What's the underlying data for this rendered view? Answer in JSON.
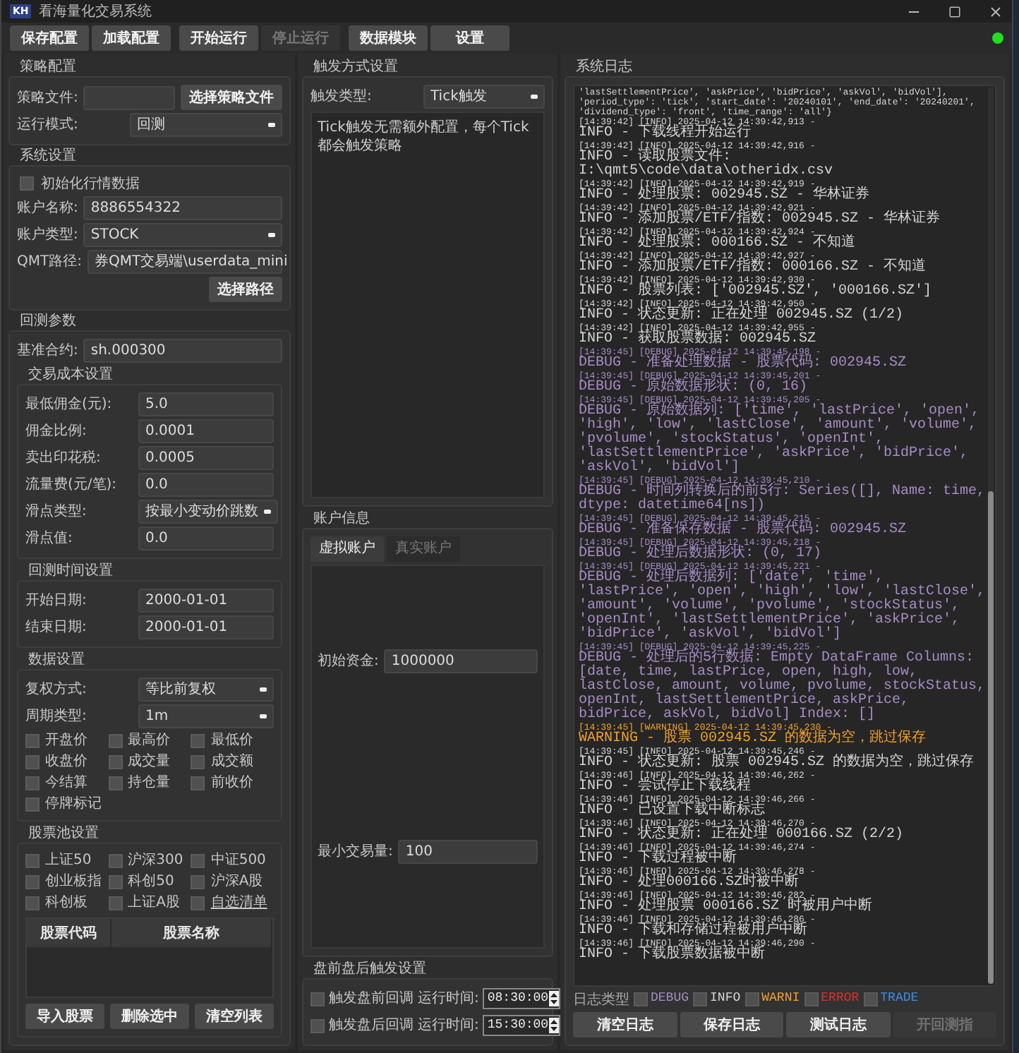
{
  "window": {
    "logo_text": "KH",
    "title": "看海量化交易系统"
  },
  "toolbar": [
    {
      "label": "保存配置",
      "disabled": false
    },
    {
      "label": "加载配置",
      "disabled": false
    },
    {
      "label": "开始运行",
      "disabled": false
    },
    {
      "label": "停止运行",
      "disabled": true
    },
    {
      "label": "数据模块",
      "disabled": false
    },
    {
      "label": "设置",
      "disabled": false
    }
  ],
  "status_light": {
    "on": true
  },
  "strategy_config": {
    "title": "策略配置",
    "file_label": "策略文件:",
    "file_button": "选择策略文件",
    "mode_label": "运行模式:",
    "mode_value": "回测"
  },
  "system_settings": {
    "title": "系统设置",
    "init_data": {
      "label": "初始化行情数据",
      "checked": false
    },
    "account_name_label": "账户名称:",
    "account_name": "8886554322",
    "account_type_label": "账户类型:",
    "account_type": "STOCK",
    "qmt_path_label": "QMT路径:",
    "qmt_path": "券QMT交易端\\userdata_mini",
    "path_button": "选择路径"
  },
  "backtest": {
    "title": "回测参数",
    "benchmark_label": "基准合约:",
    "benchmark": "sh.000300",
    "cost": {
      "title": "交易成本设置",
      "fields": [
        {
          "label": "最低佣金(元):",
          "value": "5.0",
          "kind": "input"
        },
        {
          "label": "佣金比例:",
          "value": "0.0001",
          "kind": "input"
        },
        {
          "label": "卖出印花税:",
          "value": "0.0005",
          "kind": "input"
        },
        {
          "label": "流量费(元/笔):",
          "value": "0.0",
          "kind": "input"
        },
        {
          "label": "滑点类型:",
          "value": "按最小变动价跳数",
          "kind": "select"
        },
        {
          "label": "滑点值:",
          "value": "0.0",
          "kind": "input"
        }
      ]
    },
    "period": {
      "title": "回测时间设置",
      "fields": [
        {
          "label": "开始日期:",
          "value": "2000-01-01",
          "kind": "input"
        },
        {
          "label": "结束日期:",
          "value": "2000-01-01",
          "kind": "input"
        }
      ]
    },
    "data": {
      "title": "数据设置",
      "fields": [
        {
          "label": "复权方式:",
          "value": "等比前复权",
          "kind": "select"
        },
        {
          "label": "周期类型:",
          "value": "1m",
          "kind": "select"
        }
      ],
      "columns": [
        {
          "label": "开盘价",
          "checked": false
        },
        {
          "label": "最高价",
          "checked": false
        },
        {
          "label": "最低价",
          "checked": false
        },
        {
          "label": "收盘价",
          "checked": false
        },
        {
          "label": "成交量",
          "checked": false
        },
        {
          "label": "成交额",
          "checked": false
        },
        {
          "label": "今结算",
          "checked": false
        },
        {
          "label": "持仓量",
          "checked": false
        },
        {
          "label": "前收价",
          "checked": false
        },
        {
          "label": "停牌标记",
          "checked": false
        }
      ]
    },
    "pool": {
      "title": "股票池设置",
      "indices": [
        {
          "label": "上证50",
          "checked": false,
          "kind": "plain"
        },
        {
          "label": "沪深300",
          "checked": false,
          "kind": "plain"
        },
        {
          "label": "中证500",
          "checked": false,
          "kind": "plain"
        },
        {
          "label": "创业板指",
          "checked": false,
          "kind": "plain"
        },
        {
          "label": "科创50",
          "checked": false,
          "kind": "plain"
        },
        {
          "label": "沪深A股",
          "checked": false,
          "kind": "plain"
        },
        {
          "label": "科创板",
          "checked": false,
          "kind": "plain"
        },
        {
          "label": "上证A股",
          "checked": false,
          "kind": "plain"
        },
        {
          "label": "自选清单",
          "checked": false,
          "kind": "link"
        }
      ],
      "table_columns": [
        "股票代码",
        "股票名称"
      ],
      "buttons": [
        "导入股票",
        "删除选中",
        "清空列表"
      ]
    }
  },
  "trigger": {
    "title": "触发方式设置",
    "type_label": "触发类型:",
    "type_value": "Tick触发",
    "description": "Tick触发无需额外配置，每个Tick都会触发策略"
  },
  "account_info": {
    "title": "账户信息",
    "tabs": [
      {
        "label": "虚拟账户",
        "selected": true
      },
      {
        "label": "真实账户",
        "selected": false
      }
    ],
    "fields": [
      {
        "label": "初始资金:",
        "value": "1000000"
      },
      {
        "label": "最小交易量:",
        "value": "100"
      }
    ]
  },
  "session_triggers": {
    "title": "盘前盘后触发设置",
    "rows": [
      {
        "label": "触发盘前回调",
        "checked": false,
        "time_label": "运行时间:",
        "time": "08:30:00"
      },
      {
        "label": "触发盘后回调",
        "checked": false,
        "time_label": "运行时间:",
        "time": "15:30:00"
      }
    ]
  },
  "log": {
    "title": "系统日志",
    "entries": [
      {
        "kind": "info",
        "message": "'lastSettlementPrice', 'askPrice', 'bidPrice', 'askVol', 'bidVol'], 'period_type': 'tick', 'start_date': '20240101', 'end_date': '20240201', 'dividend_type': 'front', 'time_range': 'all'}"
      },
      {
        "kind": "info",
        "header": "[14:39:42] [INFO] 2025-04-12 14:39:42,913 -",
        "message": "INFO - 下载线程开始运行"
      },
      {
        "kind": "info",
        "header": "[14:39:42] [INFO] 2025-04-12 14:39:42,916 -",
        "message": "INFO - 读取股票文件: I:\\qmt5\\code\\data\\otheridx.csv"
      },
      {
        "kind": "info",
        "header": "[14:39:42] [INFO] 2025-04-12 14:39:42,919 -",
        "message": "INFO - 处理股票: 002945.SZ - 华林证券"
      },
      {
        "kind": "info",
        "header": "[14:39:42] [INFO] 2025-04-12 14:39:42,921 -",
        "message": "INFO - 添加股票/ETF/指数: 002945.SZ - 华林证券"
      },
      {
        "kind": "info",
        "header": "[14:39:42] [INFO] 2025-04-12 14:39:42,924 -",
        "message": "INFO - 处理股票: 000166.SZ - 不知道"
      },
      {
        "kind": "info",
        "header": "[14:39:42] [INFO] 2025-04-12 14:39:42,927 -",
        "message": "INFO - 添加股票/ETF/指数: 000166.SZ - 不知道"
      },
      {
        "kind": "info",
        "header": "[14:39:42] [INFO] 2025-04-12 14:39:42,930 -",
        "message": "INFO - 股票列表: ['002945.SZ', '000166.SZ']"
      },
      {
        "kind": "info",
        "header": "[14:39:42] [INFO] 2025-04-12 14:39:42,950 -",
        "message": "INFO - 状态更新: 正在处理 002945.SZ (1/2)"
      },
      {
        "kind": "info",
        "header": "[14:39:42] [INFO] 2025-04-12 14:39:42,955 -",
        "message": "INFO - 获取股票数据: 002945.SZ"
      },
      {
        "kind": "debug",
        "header": "[14:39:45] [DEBUG] 2025-04-12 14:39:45,198 -",
        "message": "DEBUG - 准备处理数据 - 股票代码: 002945.SZ"
      },
      {
        "kind": "debug",
        "header": "[14:39:45] [DEBUG] 2025-04-12 14:39:45,201 -",
        "message": "DEBUG - 原始数据形状: (0, 16)"
      },
      {
        "kind": "debug",
        "header": "[14:39:45] [DEBUG] 2025-04-12 14:39:45,205 -",
        "message": "DEBUG - 原始数据列: ['time', 'lastPrice', 'open', 'high', 'low', 'lastClose', 'amount', 'volume', 'pvolume', 'stockStatus', 'openInt', 'lastSettlementPrice', 'askPrice', 'bidPrice', 'askVol', 'bidVol']"
      },
      {
        "kind": "debug",
        "header": "[14:39:45] [DEBUG] 2025-04-12 14:39:45,210 -",
        "message": "DEBUG - 时间列转换后的前5行: Series([], Name: time, dtype: datetime64[ns])"
      },
      {
        "kind": "debug",
        "header": "[14:39:45] [DEBUG] 2025-04-12 14:39:45,215 -",
        "message": "DEBUG - 准备保存数据 - 股票代码: 002945.SZ"
      },
      {
        "kind": "debug",
        "header": "[14:39:45] [DEBUG] 2025-04-12 14:39:45,218 -",
        "message": "DEBUG - 处理后数据形状: (0, 17)"
      },
      {
        "kind": "debug",
        "header": "[14:39:45] [DEBUG] 2025-04-12 14:39:45,221 -",
        "message": "DEBUG - 处理后数据列: ['date', 'time', 'lastPrice', 'open', 'high', 'low', 'lastClose', 'amount', 'volume', 'pvolume', 'stockStatus', 'openInt', 'lastSettlementPrice', 'askPrice', 'bidPrice', 'askVol', 'bidVol']"
      },
      {
        "kind": "debug",
        "header": "[14:39:45] [DEBUG] 2025-04-12 14:39:45,225 -",
        "message": "DEBUG - 处理后的5行数据: Empty DataFrame Columns: [date, time, lastPrice, open, high, low, lastClose, amount, volume, pvolume, stockStatus, openInt, lastSettlementPrice, askPrice, bidPrice, askVol, bidVol] Index: []"
      },
      {
        "kind": "warning",
        "header": "[14:39:45] [WARNING] 2025-04-12 14:39:45,230 -",
        "message": "WARNING - 股票 002945.SZ 的数据为空，跳过保存"
      },
      {
        "kind": "info",
        "header": "[14:39:45] [INFO] 2025-04-12 14:39:45,246 -",
        "message": "INFO - 状态更新: 股票 002945.SZ 的数据为空，跳过保存"
      },
      {
        "kind": "info",
        "header": "[14:39:46] [INFO] 2025-04-12 14:39:46,262 -",
        "message": "INFO - 尝试停止下载线程"
      },
      {
        "kind": "info",
        "header": "[14:39:46] [INFO] 2025-04-12 14:39:46,266 -",
        "message": "INFO - 已设置下载中断标志"
      },
      {
        "kind": "info",
        "header": "[14:39:46] [INFO] 2025-04-12 14:39:46,270 -",
        "message": "INFO - 状态更新: 正在处理 000166.SZ (2/2)"
      },
      {
        "kind": "info",
        "header": "[14:39:46] [INFO] 2025-04-12 14:39:46,274 -",
        "message": "INFO - 下载过程被中断"
      },
      {
        "kind": "info",
        "header": "[14:39:46] [INFO] 2025-04-12 14:39:46,278 -",
        "message": "INFO - 处理000166.SZ时被中断"
      },
      {
        "kind": "info",
        "header": "[14:39:46] [INFO] 2025-04-12 14:39:46,282 -",
        "message": "INFO - 处理股票 000166.SZ 时被用户中断"
      },
      {
        "kind": "info",
        "header": "[14:39:46] [INFO] 2025-04-12 14:39:46,286 -",
        "message": "INFO - 下载和存储过程被用户中断"
      },
      {
        "kind": "info",
        "header": "[14:39:46] [INFO] 2025-04-12 14:39:46,290 -",
        "message": "INFO - 下载股票数据被中断"
      }
    ],
    "filter_label": "日志类型",
    "filters": [
      {
        "label": "DEBUG",
        "color": "#a88cc8",
        "checked": false
      },
      {
        "label": "INFO",
        "color": "#d8d8d8",
        "checked": false
      },
      {
        "label": "WARNI",
        "color": "#f0a030",
        "checked": false
      },
      {
        "label": "ERROR",
        "color": "#e03030",
        "checked": false
      },
      {
        "label": "TRADE",
        "color": "#3a8ee6",
        "checked": false
      }
    ],
    "buttons": [
      {
        "label": "清空日志",
        "disabled": false
      },
      {
        "label": "保存日志",
        "disabled": false
      },
      {
        "label": "测试日志",
        "disabled": false
      },
      {
        "label": "开回测指",
        "disabled": true
      }
    ]
  }
}
